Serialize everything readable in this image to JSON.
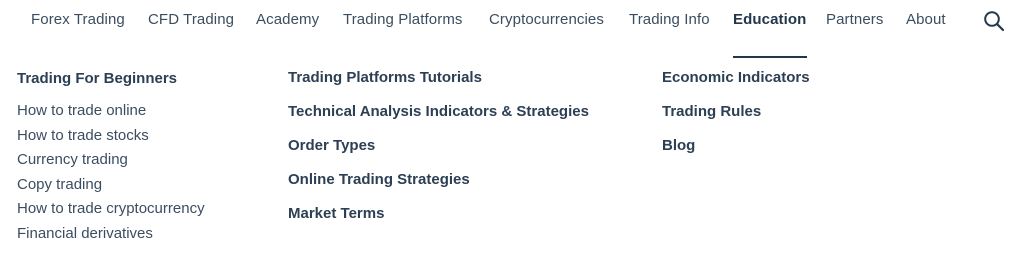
{
  "nav": {
    "items": [
      {
        "label": "Forex Trading",
        "active": false
      },
      {
        "label": "CFD Trading",
        "active": false
      },
      {
        "label": "Academy",
        "active": false
      },
      {
        "label": "Trading Platforms",
        "active": false
      },
      {
        "label": "Cryptocurrencies",
        "active": false
      },
      {
        "label": "Trading Info",
        "active": false
      },
      {
        "label": "Education",
        "active": true
      },
      {
        "label": "Partners",
        "active": false
      },
      {
        "label": "About",
        "active": false
      }
    ],
    "search_icon": "search-icon"
  },
  "mega_menu": {
    "col1": {
      "heading": "Trading For Beginners",
      "links": [
        "How to trade online",
        "How to trade stocks",
        "Currency trading",
        "Copy trading",
        "How to trade cryptocurrency",
        "Financial derivatives"
      ]
    },
    "col2": {
      "headings": [
        "Trading Platforms Tutorials",
        "Technical Analysis Indicators & Strategies",
        "Order Types",
        "Online Trading Strategies",
        "Market Terms"
      ]
    },
    "col3": {
      "headings": [
        "Economic Indicators",
        "Trading Rules",
        "Blog"
      ]
    }
  },
  "colors": {
    "text": "#3b4d60",
    "heading": "#2c3f54",
    "active": "#23374c",
    "background": "#ffffff"
  }
}
